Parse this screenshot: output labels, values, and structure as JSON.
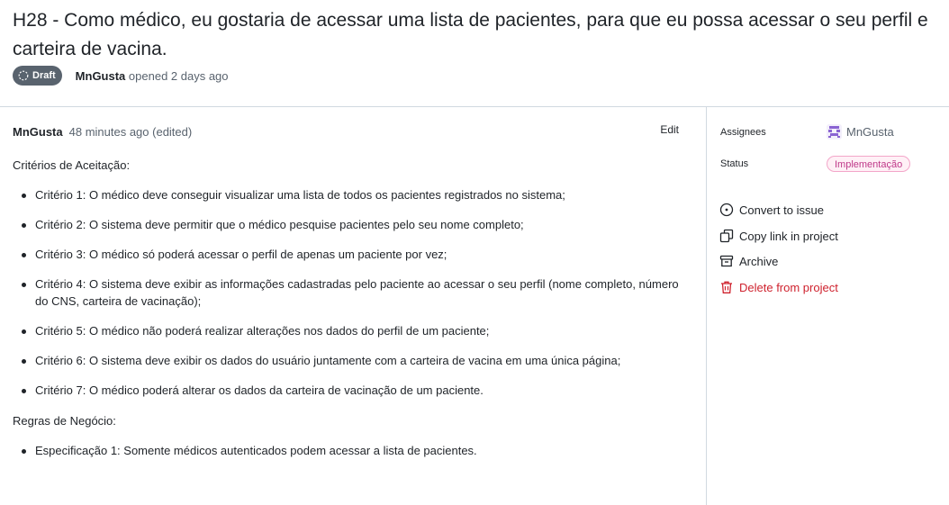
{
  "issue": {
    "title": "H28 - Como médico, eu gostaria de acessar uma lista de pacientes, para que eu possa acessar o seu perfil e carteira de vacina.",
    "state_badge": "Draft",
    "author": "MnGusta",
    "opened_text": "opened 2 days ago"
  },
  "comment": {
    "author": "MnGusta",
    "time": "48 minutes ago (edited)",
    "edit_label": "Edit",
    "sections": [
      {
        "title": "Critérios de Aceitação:",
        "items": [
          "Critério 1: O médico deve conseguir visualizar uma lista de todos os pacientes registrados no sistema;",
          "Critério 2: O sistema deve permitir que o médico pesquise pacientes pelo seu nome completo;",
          "Critério 3: O médico só poderá acessar o perfil de apenas um paciente por vez;",
          "Critério 4: O sistema deve exibir as informações cadastradas pelo paciente ao acessar o seu perfil (nome completo, número do CNS, carteira de vacinação);",
          "Critério 5: O médico não poderá realizar alterações nos dados do perfil de um paciente;",
          "Critério 6: O sistema deve exibir os dados do usuário juntamente com a carteira de vacina em uma única página;",
          "Critério 7: O médico poderá alterar os dados da carteira de vacinação de um paciente."
        ]
      },
      {
        "title": "Regras de Negócio:",
        "items": [
          "Especificação 1: Somente médicos autenticados podem acessar a lista de pacientes."
        ]
      }
    ]
  },
  "sidebar": {
    "assignees_label": "Assignees",
    "assignee_name": "MnGusta",
    "status_label": "Status",
    "status_value": "Implementação",
    "actions": [
      {
        "label": "Convert to issue",
        "icon": "convert-circle-icon"
      },
      {
        "label": "Copy link in project",
        "icon": "copy-icon"
      },
      {
        "label": "Archive",
        "icon": "archive-icon"
      },
      {
        "label": "Delete from project",
        "icon": "trash-icon"
      }
    ]
  },
  "colors": {
    "status_text": "#bf3989",
    "danger": "#cf222e",
    "badge_bg": "#59636e"
  }
}
